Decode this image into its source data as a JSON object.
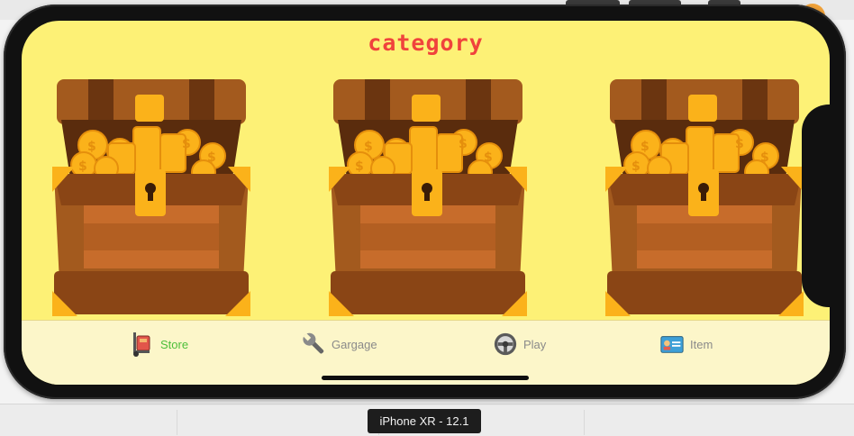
{
  "screen": {
    "title": "category"
  },
  "chests": [
    {
      "name": "treasure-chest-1"
    },
    {
      "name": "treasure-chest-2"
    },
    {
      "name": "treasure-chest-3"
    }
  ],
  "tabbar": {
    "tabs": [
      {
        "label": "Store",
        "icon": "hand-truck-icon",
        "active": true
      },
      {
        "label": "Gargage",
        "icon": "wrench-icon",
        "active": false
      },
      {
        "label": "Play",
        "icon": "steering-wheel-icon",
        "active": false
      },
      {
        "label": "Item",
        "icon": "id-card-icon",
        "active": false
      }
    ]
  },
  "simulator": {
    "device_label": "iPhone XR - 12.1"
  },
  "colors": {
    "background": "#fdf176",
    "title": "#f0433c",
    "active_tab": "#4cbf3a",
    "inactive_tab": "#8a8a8a",
    "chest_wood": "#a35a1e",
    "chest_gold": "#fbb21a"
  }
}
